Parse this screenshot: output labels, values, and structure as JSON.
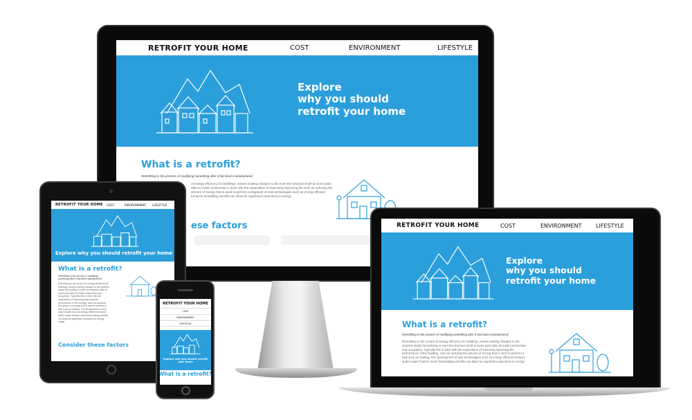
{
  "site": {
    "brand": "RETROFIT YOUR HOME",
    "nav": [
      "COST",
      "ENVIRONMENT",
      "LIFESTYLE"
    ],
    "hero_line1": "Explore",
    "hero_line2": "why you should",
    "hero_line3": "retrofit your home",
    "hero_single": "Explore why you should retrofit your home",
    "phone_hero": "Explore why you should retrofit your home",
    "section_title": "What is a retrofit?",
    "lead": "Retrofitting is the process of modifying something after it has been manufactured.",
    "body": "Retrofitting in the context of energy efficiency for buildings, means making changes to the systems inside the building or even the structure itself at some point after its initial construction and occupation. Typically this is done with the expectation of improving improving the performance of the building, such as reducing the amount of energy that is used to perform a task such as heating. The development of new technologies such as energy efficient furnaces and/or water heaters mean that building retrofits can allow for significant reductions in energy usage.",
    "monitor_body_visible": "of energy efficiency for buildings, means making changes to the even the structure itself at some point after its initial construction s done with the expectation of improving improving the such as reducing the amount of energy that is used to perform a elopment of new technologies such as energy efficient furnaces at building retrofits can allow for significant reductions in energy",
    "factors_title": "Consider these factors",
    "factors_partial": "ese factors"
  },
  "colors": {
    "brand_blue": "#2a9fdb",
    "heading_blue": "#2a9fdb"
  }
}
